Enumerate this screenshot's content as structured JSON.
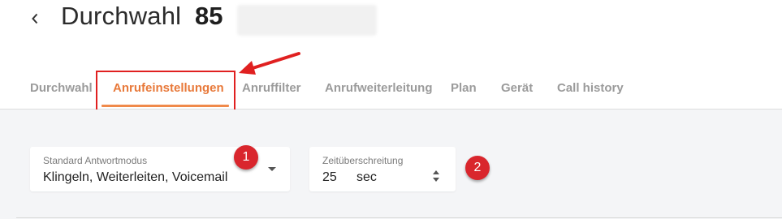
{
  "header": {
    "title": "Durchwahl",
    "extension_number": "85"
  },
  "tabs": [
    {
      "label": "Durchwahl",
      "active": false
    },
    {
      "label": "Anrufeinstellungen",
      "active": true
    },
    {
      "label": "Anruffilter",
      "active": false
    },
    {
      "label": "Anrufweiterleitung",
      "active": false
    },
    {
      "label": "Plan",
      "active": false
    },
    {
      "label": "Gerät",
      "active": false
    },
    {
      "label": "Call history",
      "active": false
    }
  ],
  "settings": {
    "answer_mode": {
      "label": "Standard Antwortmodus",
      "value": "Klingeln, Weiterleiten, Voicemail"
    },
    "timeout": {
      "label": "Zeitüberschreitung",
      "value": "25",
      "unit": "sec"
    }
  },
  "annotations": {
    "badge_1": "1",
    "badge_2": "2"
  },
  "colors": {
    "accent": "#e8793a",
    "tab_underline": "#f08a4b",
    "annotation_red": "#d9262d",
    "content_background": "#f4f5f7"
  },
  "icons": {
    "back": "chevron-left-icon",
    "select": "caret-down-icon",
    "spinner": "spinner-arrows-icon",
    "annotation": "arrow-icon"
  }
}
